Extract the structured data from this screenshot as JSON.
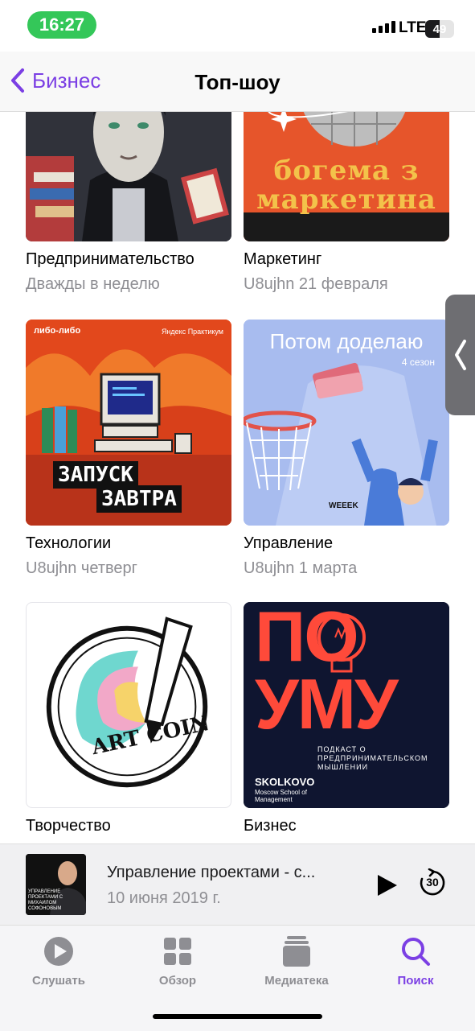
{
  "status_bar": {
    "time": "16:27",
    "network": "LTE",
    "battery": "49",
    "battery_fraction": 0.49
  },
  "nav": {
    "back_label": "Бизнес",
    "title": "Топ-шоу"
  },
  "shows": [
    {
      "title": "Предпринимательство",
      "subtitle": "Дважды в неделю",
      "art_icon": "portrait-illustration"
    },
    {
      "title": "Маркетинг",
      "subtitle": "U8ujhn 21 февраля",
      "art_icon": "disco-ball",
      "art_text": "богема з маркетина"
    },
    {
      "title": "Технологии",
      "subtitle": "U8ujhn четверг",
      "art_icon": "retro-computer",
      "art_text": [
        "ЗАПУСК",
        "ЗАВТРА"
      ],
      "art_top_left": "либо-либо",
      "art_top_right": "Яндекс Практикум"
    },
    {
      "title": "Управление",
      "subtitle": "U8ujhn 1 марта",
      "art_icon": "basketball-hoop",
      "art_text": "Потом доделаю",
      "art_season": "4 сезон",
      "art_brand": "WEEEK"
    },
    {
      "title": "Творчество",
      "subtitle": "",
      "art_icon": "pencil-circle",
      "art_text": "ART COIN"
    },
    {
      "title": "Бизнес",
      "subtitle": "",
      "art_icon": "lightbulb",
      "art_text": [
        "ПО",
        "УМУ"
      ],
      "art_desc": "ПОДКАСТ О ПРЕДПРИНИМАТЕЛЬСКОМ МЫШЛЕНИИ",
      "art_brand": "SKOLKOVO",
      "art_brand_sub": "Moscow School of Management"
    }
  ],
  "mini_player": {
    "title": "Управление проектами - с...",
    "date": "10 июня 2019 г.",
    "art_caption": "УПРАВЛЕНИЕ ПРОЕКТАМИ С МИХАИЛОМ СОФОНОВЫМ",
    "skip_seconds": "30"
  },
  "tabs": [
    {
      "label": "Слушать",
      "icon": "play-circle-icon",
      "active": false
    },
    {
      "label": "Обзор",
      "icon": "grid-icon",
      "active": false
    },
    {
      "label": "Медиатека",
      "icon": "library-icon",
      "active": false
    },
    {
      "label": "Поиск",
      "icon": "search-icon",
      "active": true
    }
  ],
  "colors": {
    "accent": "#7b3fe4",
    "status_pill": "#34c759",
    "secondary_text": "#8e8e93"
  }
}
